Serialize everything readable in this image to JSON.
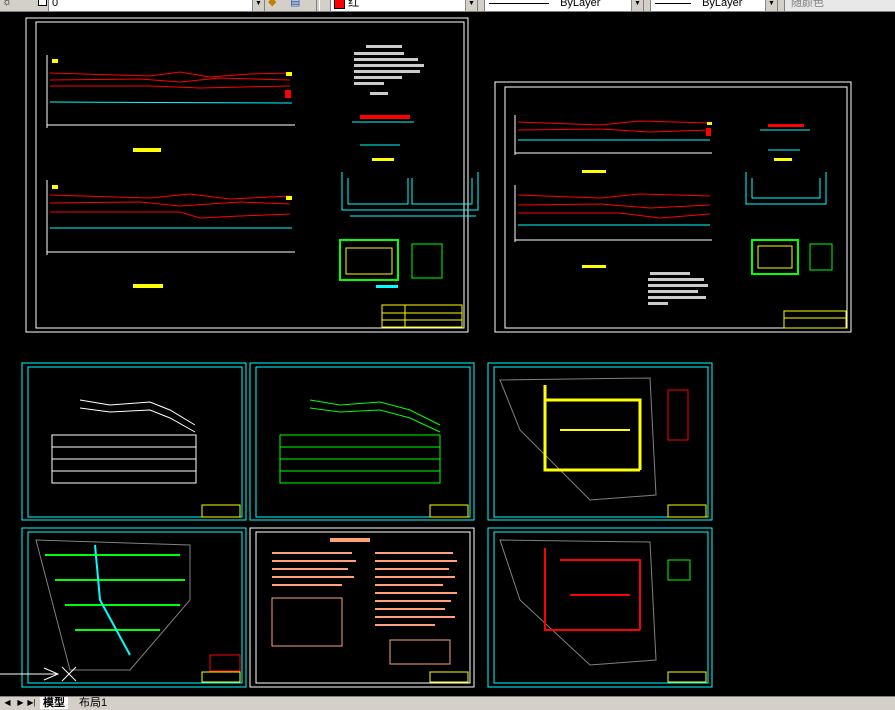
{
  "toolbar": {
    "layer_name": "0",
    "color_name": "红",
    "color_hex": "#ff0000",
    "linetype_value": "ByLayer",
    "lineweight_value": "ByLayer",
    "plotstyle_value": "随颜色"
  },
  "layout_tabs": {
    "model": "模型",
    "layout1": "布局1"
  },
  "drawing": {
    "colors": {
      "background": "#000000",
      "frame": "#ffffff",
      "sheet_frame": "#00ffff",
      "pipe_red": "#ff0000",
      "pipe_cyan": "#00ffff",
      "green": "#00ff00",
      "yellow": "#ffff00",
      "salmon": "#ffa07a",
      "magenta": "#ff00ff"
    },
    "sheets": [
      {
        "id": "sheet-top-left",
        "content": "longitudinal-profiles"
      },
      {
        "id": "sheet-top-right",
        "content": "longitudinal-profiles"
      },
      {
        "id": "sheet-row2-1",
        "content": "profile-table-white"
      },
      {
        "id": "sheet-row2-2",
        "content": "profile-table-green"
      },
      {
        "id": "sheet-row2-3",
        "content": "site-plan-yellow"
      },
      {
        "id": "sheet-row3-1",
        "content": "site-plan-green"
      },
      {
        "id": "sheet-row3-2",
        "content": "design-notes"
      },
      {
        "id": "sheet-row3-3",
        "content": "site-plan-red"
      }
    ]
  }
}
